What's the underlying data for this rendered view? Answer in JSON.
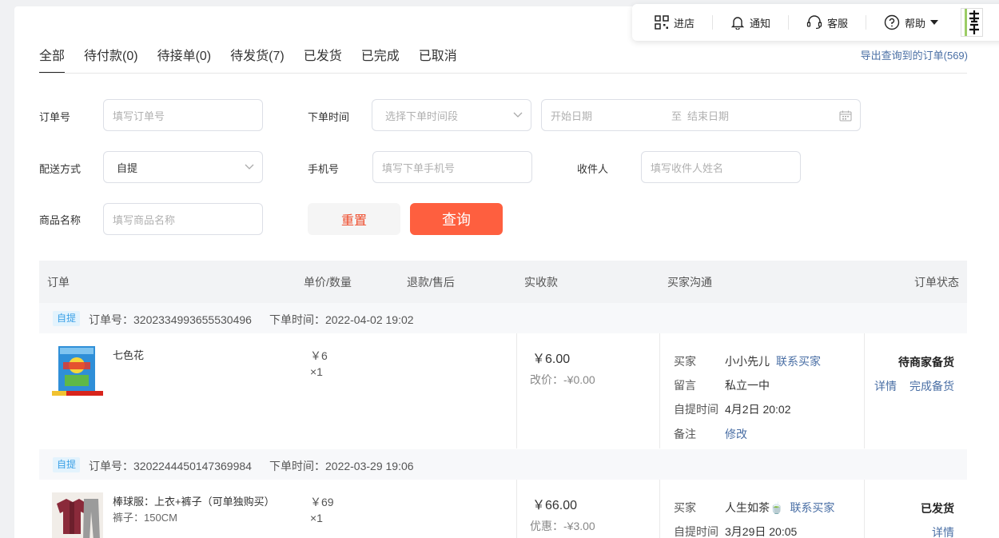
{
  "topbar": {
    "shop": "进店",
    "notify": "通知",
    "service": "客服",
    "help": "帮助"
  },
  "tabs": [
    {
      "label": "全部"
    },
    {
      "label": "待付款(0)"
    },
    {
      "label": "待接单(0)"
    },
    {
      "label": "待发货(7)"
    },
    {
      "label": "已发货"
    },
    {
      "label": "已完成"
    },
    {
      "label": "已取消"
    }
  ],
  "export_link": "导出查询到的订单(569)",
  "filters": {
    "order_no_label": "订单号",
    "order_no_placeholder": "填写订单号",
    "time_label": "下单时间",
    "time_select_placeholder": "选择下单时间段",
    "start_date_placeholder": "开始日期",
    "range_to": "至",
    "end_date_placeholder": "结束日期",
    "delivery_label": "配送方式",
    "delivery_value": "自提",
    "phone_label": "手机号",
    "phone_placeholder": "填写下单手机号",
    "receiver_label": "收件人",
    "receiver_placeholder": "填写收件人姓名",
    "product_label": "商品名称",
    "product_placeholder": "填写商品名称",
    "reset": "重置",
    "query": "查询"
  },
  "table_headers": {
    "order": "订单",
    "price_qty": "单价/数量",
    "refund": "退款/售后",
    "paid": "实收款",
    "buyer_comm": "买家沟通",
    "status": "订单状态"
  },
  "orders": [
    {
      "tag": "自提",
      "order_no": "订单号：3202334993655530496",
      "time": "下单时间：2022-04-02 19:02",
      "product_name": "七色花",
      "price": "￥6",
      "qty": "×1",
      "paid": "￥6.00",
      "paid_sub": "改价：-¥0.00",
      "buyer_k": "买家",
      "buyer_v": "小小先儿",
      "contact": "联系买家",
      "msg_k": "留言",
      "msg_v": "私立一中",
      "pick_k": "自提时间",
      "pick_v": "4月2日 20:02",
      "note_k": "备注",
      "note_link": "修改",
      "status": "待商家备货",
      "act1": "详情",
      "act2": "完成备货"
    },
    {
      "tag": "自提",
      "order_no": "订单号：3202244450147369984",
      "time": "下单时间：2022-03-29 19:06",
      "product_name": "棒球服：上衣+裤子（可单独购买）",
      "product_sku": "裤子：150CM",
      "price": "￥69",
      "qty": "×1",
      "paid": "￥66.00",
      "paid_sub": "优惠：-¥3.00",
      "buyer_k": "买家",
      "buyer_v": "人生如茶🍵",
      "contact": "联系买家",
      "pick_k": "自提时间",
      "pick_v": "3月29日 20:05",
      "status": "已发货",
      "act1": "详情"
    }
  ],
  "colors": {
    "accent": "#fe5f3f",
    "link": "#4a6fa5",
    "tag_bg": "#e3f3fd",
    "tag_text": "#3aa0e6"
  }
}
